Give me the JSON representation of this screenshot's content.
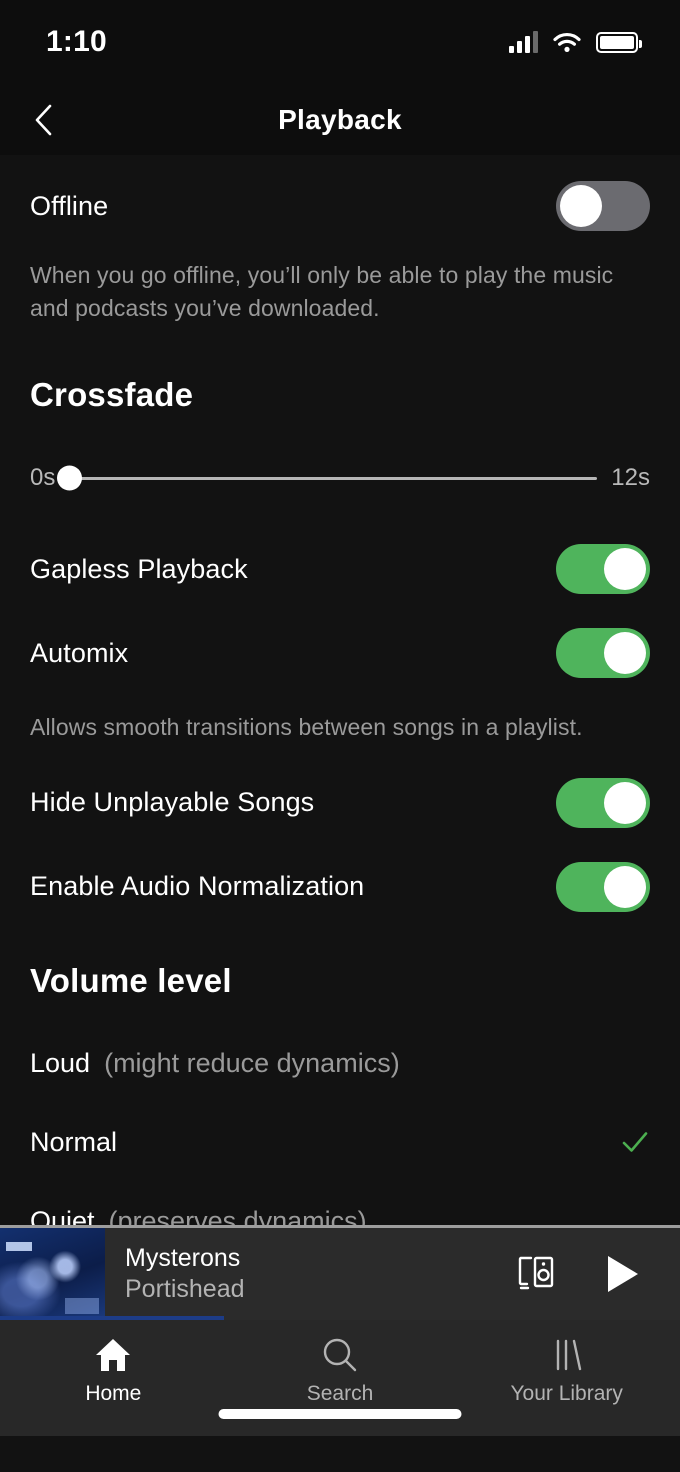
{
  "status_bar": {
    "time": "1:10",
    "cellular_icon": "cellular-bars-icon",
    "wifi_icon": "wifi-icon",
    "battery_icon": "battery-full-icon"
  },
  "header": {
    "back_icon": "chevron-left-icon",
    "title": "Playback"
  },
  "settings": {
    "offline": {
      "label": "Offline",
      "toggle_state": "off",
      "description": "When you go offline, you’ll only be able to play the music and podcasts you’ve downloaded."
    },
    "crossfade": {
      "title": "Crossfade",
      "min_label": "0s",
      "max_label": "12s",
      "value": 0,
      "min": 0,
      "max": 12
    },
    "gapless_playback": {
      "label": "Gapless Playback",
      "toggle_state": "on"
    },
    "automix": {
      "label": "Automix",
      "toggle_state": "on",
      "description": "Allows smooth transitions between songs in a playlist."
    },
    "hide_unplayable_songs": {
      "label": "Hide Unplayable Songs",
      "toggle_state": "on"
    },
    "enable_audio_normalization": {
      "label": "Enable Audio Normalization",
      "toggle_state": "on"
    },
    "volume_level": {
      "title": "Volume level",
      "options": [
        {
          "name": "Loud",
          "note": "(might reduce dynamics)",
          "selected": false
        },
        {
          "name": "Normal",
          "note": "",
          "selected": true
        },
        {
          "name": "Quiet",
          "note": "(preserves dynamics)",
          "selected": false
        }
      ]
    }
  },
  "now_playing": {
    "album_art": "album-art-thumbnail",
    "track": "Mysterons",
    "artist": "Portishead",
    "devices_icon": "connect-to-device-icon",
    "play_icon": "play-icon"
  },
  "bottom_nav": [
    {
      "label": "Home",
      "icon": "home-icon",
      "active": true
    },
    {
      "label": "Search",
      "icon": "search-icon",
      "active": false
    },
    {
      "label": "Your Library",
      "icon": "library-icon",
      "active": false
    }
  ],
  "colors": {
    "background": "#121212",
    "toggle_on": "#4fb45c",
    "toggle_off": "#6b6b70",
    "check_green": "#4caf50",
    "secondary_text": "#9a9a9a",
    "player_bar": "#2b2b2b",
    "nav_bar": "#282828"
  }
}
